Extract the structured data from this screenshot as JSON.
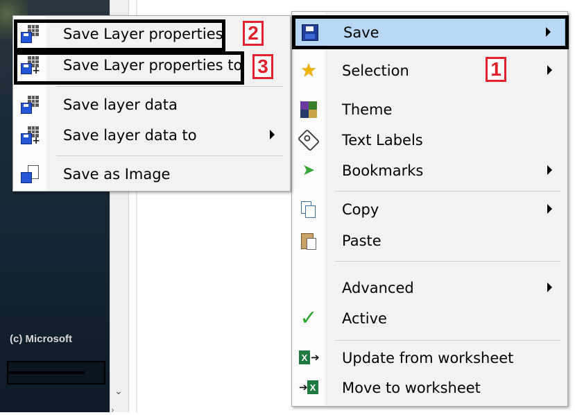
{
  "background": {
    "copyright": "(c) Microsoft"
  },
  "main_menu": {
    "items": [
      {
        "label": "Save",
        "icon": "floppy-disk-icon",
        "has_submenu": true,
        "highlighted": true
      },
      {
        "label": "Selection",
        "icon": "star-icon",
        "has_submenu": true
      },
      {
        "label": "Theme",
        "icon": "theme-icon",
        "has_submenu": false
      },
      {
        "label": "Text Labels",
        "icon": "tag-icon",
        "has_submenu": false
      },
      {
        "label": "Bookmarks",
        "icon": "bookmark-icon",
        "has_submenu": true
      },
      {
        "label": "Copy",
        "icon": "copy-icon",
        "has_submenu": true
      },
      {
        "label": "Paste",
        "icon": "paste-icon",
        "has_submenu": false
      },
      {
        "label": "Advanced",
        "icon": "",
        "has_submenu": true
      },
      {
        "label": "Active",
        "icon": "checkmark-icon",
        "has_submenu": false
      },
      {
        "label": "Update from worksheet",
        "icon": "excel-import-icon",
        "has_submenu": false
      },
      {
        "label": "Move to worksheet",
        "icon": "excel-export-icon",
        "has_submenu": false
      }
    ]
  },
  "save_submenu": {
    "items": [
      {
        "label": "Save Layer properties",
        "icon": "save-table-icon",
        "has_submenu": false
      },
      {
        "label": "Save Layer properties to",
        "icon": "save-table-to-icon",
        "has_submenu": false
      },
      {
        "label": "Save layer data",
        "icon": "save-table-icon",
        "has_submenu": false
      },
      {
        "label": "Save layer data to",
        "icon": "save-table-to-icon",
        "has_submenu": true
      },
      {
        "label": "Save as Image",
        "icon": "save-image-icon",
        "has_submenu": false
      }
    ]
  },
  "annotations": {
    "badge_1": "1",
    "badge_2": "2",
    "badge_3": "3",
    "color": "#e0202a"
  },
  "colors": {
    "highlight": "#b9d8f5",
    "menu_bg": "#f2f2f2"
  }
}
